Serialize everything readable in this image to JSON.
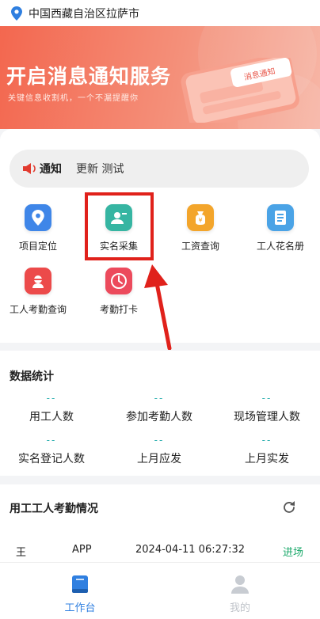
{
  "location": {
    "text": "中国西藏自治区拉萨市",
    "icon": "map-pin-icon"
  },
  "banner": {
    "title": "开启消息通知服务",
    "subtitle": "关键信息收割机，一个不漏提醒你",
    "card_text": "消息通知"
  },
  "notice": {
    "label": "通知",
    "text": "更新 测试",
    "icon": "speaker-icon"
  },
  "grid": [
    {
      "label": "项目定位",
      "icon": "location-icon",
      "color": "#3f86e8"
    },
    {
      "label": "实名采集",
      "icon": "id-collect-icon",
      "color": "#36b5a2"
    },
    {
      "label": "工资查询",
      "icon": "wage-bag-icon",
      "color": "#f3a52b"
    },
    {
      "label": "工人花名册",
      "icon": "roster-book-icon",
      "color": "#4aa3e6"
    },
    {
      "label": "工人考勤查询",
      "icon": "attendance-face-icon",
      "color": "#ec4a4a"
    },
    {
      "label": "考勤打卡",
      "icon": "clock-icon",
      "color": "#ec4a5c"
    }
  ],
  "stats": {
    "title": "数据统计",
    "items": [
      {
        "value": "--",
        "label": "用工人数"
      },
      {
        "value": "--",
        "label": "参加考勤人数"
      },
      {
        "value": "--",
        "label": "现场管理人数"
      },
      {
        "value": "--",
        "label": "实名登记人数"
      },
      {
        "value": "--",
        "label": "上月应发"
      },
      {
        "value": "--",
        "label": "上月实发"
      }
    ]
  },
  "attendance": {
    "title": "用工工人考勤情况",
    "rows": [
      {
        "name": "王",
        "source": "APP",
        "time": "2024-04-11 06:27:32",
        "status": "进场"
      }
    ]
  },
  "tabbar": {
    "tabs": [
      {
        "label": "工作台",
        "icon": "workbench-book-icon",
        "active": true
      },
      {
        "label": "我的",
        "icon": "user-profile-icon",
        "active": false
      }
    ]
  },
  "colors": {
    "accent": "#2f7fe0",
    "teal": "#33b2b2",
    "green": "#1aa86a",
    "highlight": "#e0211b"
  }
}
